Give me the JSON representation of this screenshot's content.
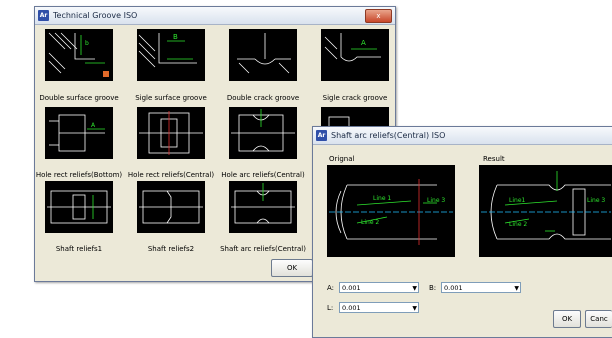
{
  "groove_dialog": {
    "title": "Technical Groove ISO",
    "app_icon": "Ar",
    "close_glyph": "x",
    "items": [
      {
        "label": "Double surface groove"
      },
      {
        "label": "Sigle surface groove"
      },
      {
        "label": "Double crack groove"
      },
      {
        "label": "Sigle crack groove"
      },
      {
        "label": "Hole rect reliefs(Bottom)"
      },
      {
        "label": "Hole rect reliefs(Central)"
      },
      {
        "label": "Hole arc reliefs(Central)"
      },
      {
        "label": ""
      },
      {
        "label": "Shaft reliefs1"
      },
      {
        "label": "Shaft reliefs2"
      },
      {
        "label": "Shaft arc reliefs(Central)"
      }
    ],
    "ok_label": "OK"
  },
  "shaft_dialog": {
    "title": "Shaft arc reliefs(Central) ISO",
    "app_icon": "Ar",
    "original_label": "Orignal",
    "result_label": "Result",
    "orig_line1": "Line 1",
    "orig_line2": "Line 2",
    "orig_line3": "Line 3",
    "res_line1": "Line1",
    "res_line2": "Line 2",
    "res_line3": "Line 3",
    "a_label": "A:",
    "a_value": "0.001",
    "b_label": "B:",
    "b_value": "0.001",
    "l_label": "L:",
    "l_value": "0.001",
    "ok_label": "OK",
    "cancel_label": "Canc"
  },
  "colors": {
    "cad_bg": "#000000",
    "cad_line": "#ffffff",
    "cad_dim": "#2ee62e",
    "cad_axis": "#20c0ff"
  }
}
